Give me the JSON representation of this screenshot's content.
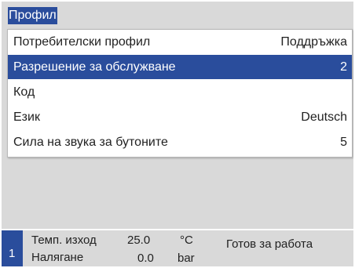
{
  "title": "Профил",
  "menu": [
    {
      "label": "Потребителски профил",
      "value": "Поддръжка"
    },
    {
      "label": "Разрешение за обслужване",
      "value": "2",
      "selected": true
    },
    {
      "label": "Код",
      "value": ""
    },
    {
      "label": "Език",
      "value": "Deutsch"
    },
    {
      "label": "Сила на звука за бутоните",
      "value": "5"
    }
  ],
  "status": {
    "channel": "1",
    "rows": [
      {
        "label": "Темп. изход",
        "value": "25.0",
        "unit": "°C"
      },
      {
        "label": "Налягане",
        "value": "0.0",
        "unit": "bar"
      }
    ],
    "message": "Готов за работа"
  },
  "colors": {
    "accent": "#2a4d9c",
    "background": "#d9d9d9",
    "panel": "#ffffff"
  }
}
